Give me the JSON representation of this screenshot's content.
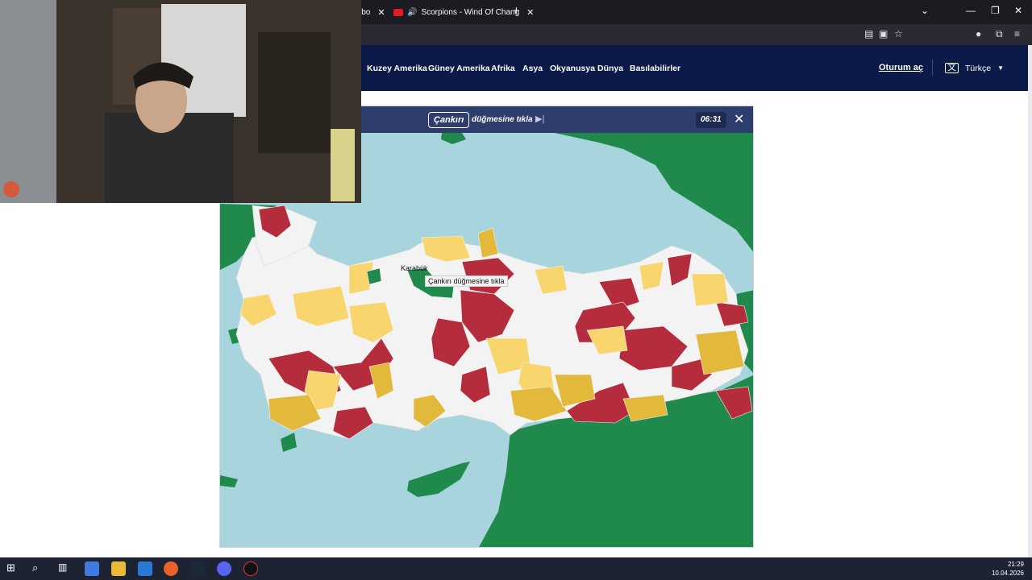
{
  "browser": {
    "tabs": [
      {
        "title": "ibo"
      },
      {
        "title": "Scorpions - Wind Of Chang"
      }
    ]
  },
  "site": {
    "nav": [
      "Kuzey Amerika",
      "Güney Amerika",
      "Afrika",
      "Asya",
      "Okyanusya",
      "Dünya",
      "Basılabilirler"
    ],
    "login": "Oturum aç",
    "language": "Türkçe"
  },
  "game": {
    "target": "Çankırı",
    "instruction": "düğmesine tıkla",
    "timer": "06:31",
    "hover_label": "Karabük",
    "tooltip": "Çankırı düğmesine tıkla"
  },
  "taskbar": {
    "time": "21:29",
    "date": "10.04.2026"
  },
  "colors": {
    "correct": "#f7f7f7",
    "second_try": "#f8d66d",
    "third_try": "#e3b93c",
    "wrong": "#b52c3d",
    "neighbor_land": "#1f8a4c",
    "sea": "#a8d5dd",
    "nav_bg": "#0b1a49",
    "game_bar": "#2f3d6c"
  }
}
